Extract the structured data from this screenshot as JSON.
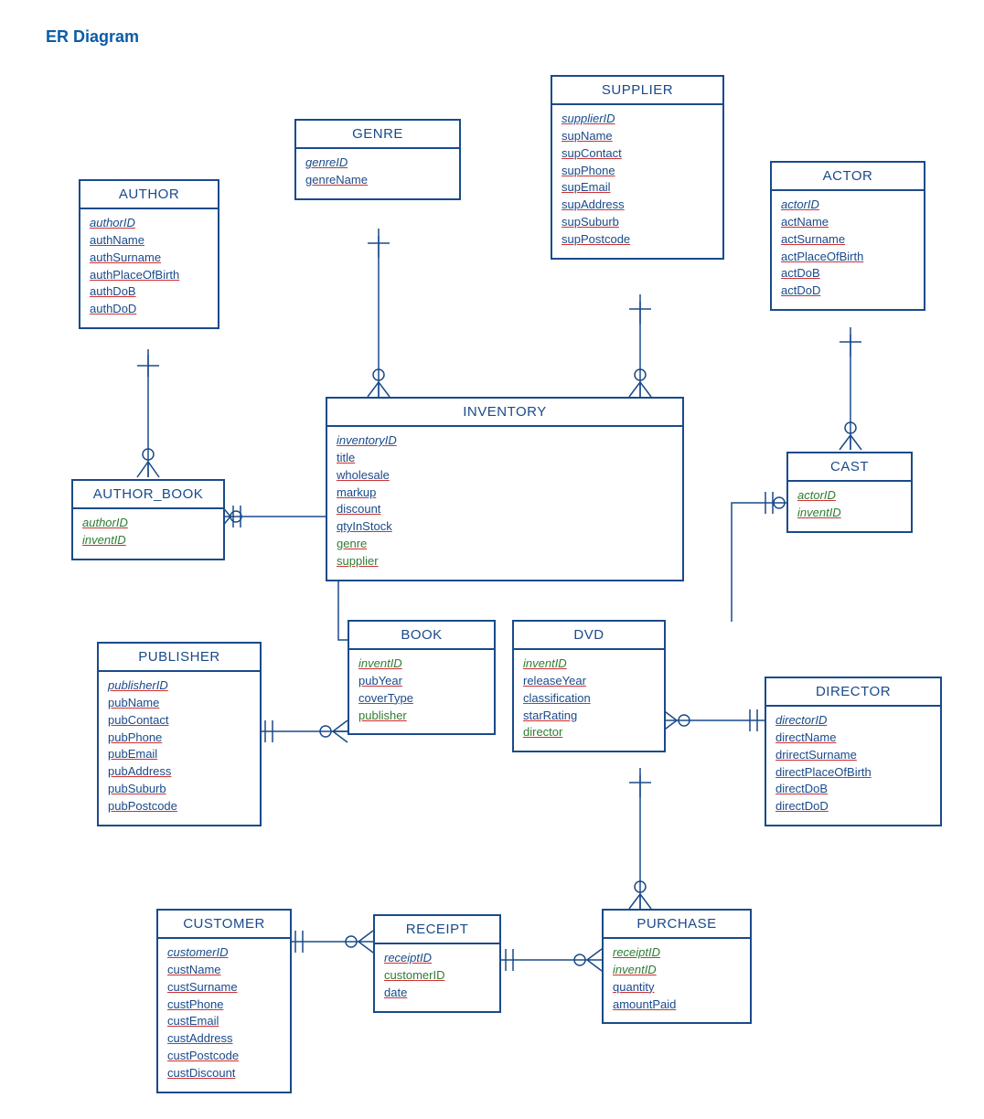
{
  "page_title": "ER Diagram",
  "entities": {
    "author": {
      "name": "AUTHOR",
      "attrs": [
        "authorID",
        "authName",
        "authSurname",
        "authPlaceOfBirth",
        "authDoB",
        "authDoD"
      ],
      "pk": [
        "authorID"
      ]
    },
    "author_book": {
      "name": "AUTHOR_BOOK",
      "attrs": [
        "authorID",
        "inventID"
      ],
      "pk": [
        "authorID",
        "inventID"
      ],
      "fk": [
        "authorID",
        "inventID"
      ]
    },
    "genre": {
      "name": "GENRE",
      "attrs": [
        "genreID",
        "genreName"
      ],
      "pk": [
        "genreID"
      ]
    },
    "supplier": {
      "name": "SUPPLIER",
      "attrs": [
        "supplierID",
        "supName",
        "supContact",
        "supPhone",
        "supEmail",
        "supAddress",
        "supSuburb",
        "supPostcode"
      ],
      "pk": [
        "supplierID"
      ]
    },
    "actor": {
      "name": "ACTOR",
      "attrs": [
        "actorID",
        "actName",
        "actSurname",
        "actPlaceOfBirth",
        "actDoB",
        "actDoD"
      ],
      "pk": [
        "actorID"
      ]
    },
    "inventory": {
      "name": "INVENTORY",
      "attrs": [
        "inventoryID",
        "title",
        "wholesale",
        "markup",
        "discount",
        "qtyInStock",
        "genre",
        "supplier"
      ],
      "pk": [
        "inventoryID"
      ],
      "fk": [
        "genre",
        "supplier"
      ]
    },
    "cast": {
      "name": "CAST",
      "attrs": [
        "actorID",
        "inventID"
      ],
      "pk": [
        "actorID",
        "inventID"
      ],
      "fk": [
        "actorID",
        "inventID"
      ]
    },
    "book": {
      "name": "BOOK",
      "attrs": [
        "inventID",
        "pubYear",
        "coverType",
        "publisher"
      ],
      "pk": [
        "inventID"
      ],
      "fk": [
        "inventID",
        "publisher"
      ]
    },
    "dvd": {
      "name": "DVD",
      "attrs": [
        "inventID",
        "releaseYear",
        "classification",
        "starRating",
        "director"
      ],
      "pk": [
        "inventID"
      ],
      "fk": [
        "inventID",
        "director"
      ]
    },
    "publisher": {
      "name": "PUBLISHER",
      "attrs": [
        "publisherID",
        "pubName",
        "pubContact",
        "pubPhone",
        "pubEmail",
        "pubAddress",
        "pubSuburb",
        "pubPostcode"
      ],
      "pk": [
        "publisherID"
      ]
    },
    "director": {
      "name": "DIRECTOR",
      "attrs": [
        "directorID",
        "directName",
        "drirectSurname",
        "directPlaceOfBirth",
        "directDoB",
        "directDoD"
      ],
      "pk": [
        "directorID"
      ]
    },
    "customer": {
      "name": "CUSTOMER",
      "attrs": [
        "customerID",
        "custName",
        "custSurname",
        "custPhone",
        "custEmail",
        "custAddress",
        "custPostcode",
        "custDiscount"
      ],
      "pk": [
        "customerID"
      ]
    },
    "receipt": {
      "name": "RECEIPT",
      "attrs": [
        "receiptID",
        "customerID",
        "date"
      ],
      "pk": [
        "receiptID"
      ],
      "fk": [
        "customerID"
      ]
    },
    "purchase": {
      "name": "PURCHASE",
      "attrs": [
        "receiptID",
        "inventID",
        "quantity",
        "amountPaid"
      ],
      "pk": [
        "receiptID",
        "inventID"
      ],
      "fk": [
        "receiptID",
        "inventID"
      ]
    }
  },
  "relationships": [
    {
      "from": "AUTHOR",
      "to": "AUTHOR_BOOK",
      "card_from": "1..1",
      "card_to": "0..*"
    },
    {
      "from": "AUTHOR_BOOK",
      "to": "BOOK",
      "card_from": "0..*",
      "card_to": "1..1"
    },
    {
      "from": "GENRE",
      "to": "INVENTORY",
      "card_from": "1..1",
      "card_to": "0..*"
    },
    {
      "from": "SUPPLIER",
      "to": "INVENTORY",
      "card_from": "1..1",
      "card_to": "0..*"
    },
    {
      "from": "ACTOR",
      "to": "CAST",
      "card_from": "1..1",
      "card_to": "0..*"
    },
    {
      "from": "CAST",
      "to": "DVD",
      "card_from": "0..*",
      "card_to": "1..1"
    },
    {
      "from": "PUBLISHER",
      "to": "BOOK",
      "card_from": "1..1",
      "card_to": "0..*"
    },
    {
      "from": "DVD",
      "to": "DIRECTOR",
      "card_from": "0..*",
      "card_to": "1..1"
    },
    {
      "from": "INVENTORY",
      "to": "PURCHASE",
      "card_from": "1..1",
      "card_to": "0..*"
    },
    {
      "from": "RECEIPT",
      "to": "PURCHASE",
      "card_from": "1..1",
      "card_to": "0..*"
    },
    {
      "from": "CUSTOMER",
      "to": "RECEIPT",
      "card_from": "1..1",
      "card_to": "0..*"
    }
  ]
}
